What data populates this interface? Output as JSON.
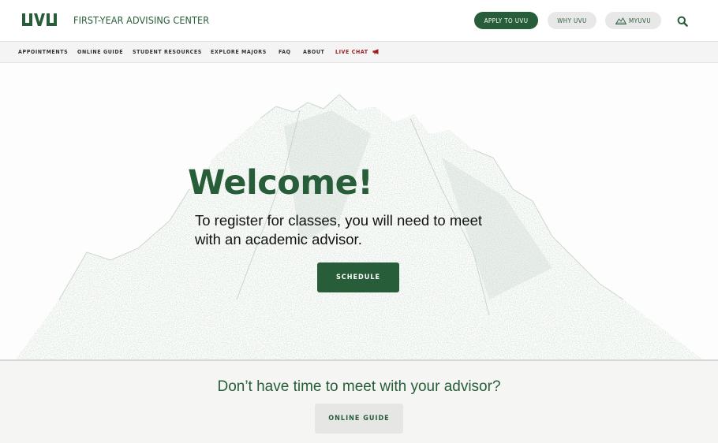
{
  "header": {
    "logo_text": "UVU",
    "department": "FIRST-YEAR ADVISING CENTER",
    "buttons": {
      "apply": "APPLY TO UVU",
      "why": "WHY UVU",
      "myuvu": "MYUVU"
    },
    "search_icon": "search-icon"
  },
  "nav": {
    "items": [
      {
        "label": "APPOINTMENTS"
      },
      {
        "label": "ONLINE GUIDE"
      },
      {
        "label": "STUDENT RESOURCES"
      },
      {
        "label": "EXPLORE MAJORS"
      },
      {
        "label": "FAQ"
      },
      {
        "label": "ABOUT"
      },
      {
        "label": "LIVE CHAT",
        "icon": "megaphone-icon"
      }
    ]
  },
  "hero": {
    "title": "Welcome!",
    "subtitle": "To register for classes, you will need to meet with an academic advisor.",
    "button": "SCHEDULE"
  },
  "band": {
    "title": "Don’t have time to meet with your advisor?",
    "button": "ONLINE GUIDE"
  },
  "colors": {
    "brand_green": "#275d38",
    "live_chat_red": "#9a1c1c",
    "pill_gray": "#e8e8e8",
    "nav_bg": "#f4f4f4",
    "band_bg": "#f5f5f4"
  }
}
